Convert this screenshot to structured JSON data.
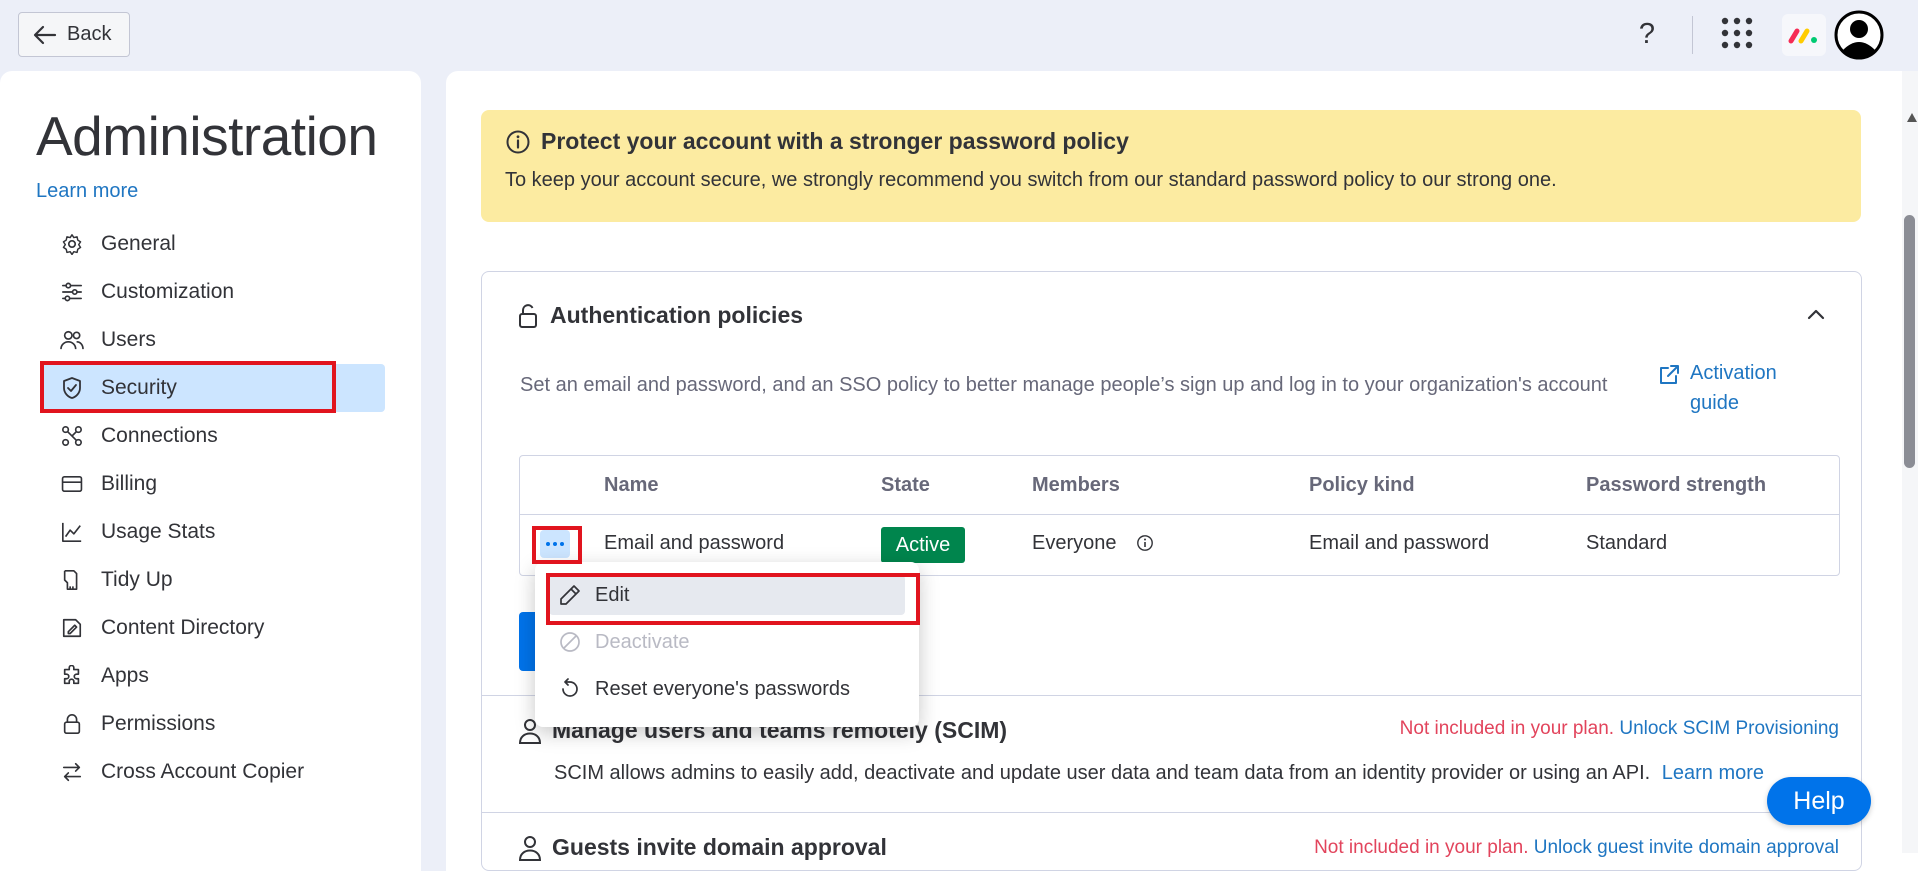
{
  "topbar": {
    "back_label": "Back",
    "help_symbol": "?",
    "icons": [
      "arrow-left-icon",
      "help-icon",
      "apps-grid-icon",
      "monday-logo-icon",
      "avatar-icon"
    ]
  },
  "sidebar": {
    "title": "Administration",
    "learn_more": "Learn more",
    "items": [
      {
        "label": "General",
        "icon": "gear-icon"
      },
      {
        "label": "Customization",
        "icon": "sliders-icon"
      },
      {
        "label": "Users",
        "icon": "users-icon"
      },
      {
        "label": "Security",
        "icon": "shield-icon",
        "active": true
      },
      {
        "label": "Connections",
        "icon": "connections-icon"
      },
      {
        "label": "Billing",
        "icon": "credit-card-icon"
      },
      {
        "label": "Usage Stats",
        "icon": "line-chart-icon"
      },
      {
        "label": "Tidy Up",
        "icon": "broom-icon"
      },
      {
        "label": "Content Directory",
        "icon": "content-directory-icon"
      },
      {
        "label": "Apps",
        "icon": "puzzle-icon"
      },
      {
        "label": "Permissions",
        "icon": "lock-icon"
      },
      {
        "label": "Cross Account Copier",
        "icon": "swap-icon"
      }
    ]
  },
  "banner": {
    "title": "Protect your account with a stronger password policy",
    "text": "To keep your account secure, we strongly recommend you switch from our standard password policy to our strong one."
  },
  "auth": {
    "title": "Authentication policies",
    "description": "Set an email and password, and an SSO policy to better manage people’s sign up and log in to your organization's account",
    "activation_guide": "Activation guide",
    "columns": [
      "Name",
      "State",
      "Members",
      "Policy kind",
      "Password strength"
    ],
    "row": {
      "name": "Email and password",
      "state": "Active",
      "members": "Everyone",
      "policy_kind": "Email and password",
      "password_strength": "Standard"
    }
  },
  "menu": {
    "items": [
      {
        "label": "Edit",
        "icon": "pencil-icon"
      },
      {
        "label": "Deactivate",
        "icon": "ban-icon",
        "disabled": true
      },
      {
        "label": "Reset everyone's passwords",
        "icon": "reset-icon"
      }
    ]
  },
  "scim": {
    "title": "Manage users and teams remotely (SCIM)",
    "not_included": "Not included in your plan.",
    "unlock": "Unlock SCIM Provisioning",
    "description": "SCIM allows admins to easily add, deactivate and update user data and team data from an identity provider or using an API.",
    "learn_more": "Learn more"
  },
  "guests": {
    "title": "Guests invite domain approval",
    "not_included": "Not included in your plan.",
    "unlock": "Unlock guest invite domain approval"
  },
  "help_button": "Help",
  "colors": {
    "accent": "#0073ea",
    "active_nav_bg": "#cce5ff",
    "banner_bg": "#fceba1",
    "status_active": "#00854d",
    "not_included": "#e2445c",
    "annotation_red": "#e1141e"
  }
}
